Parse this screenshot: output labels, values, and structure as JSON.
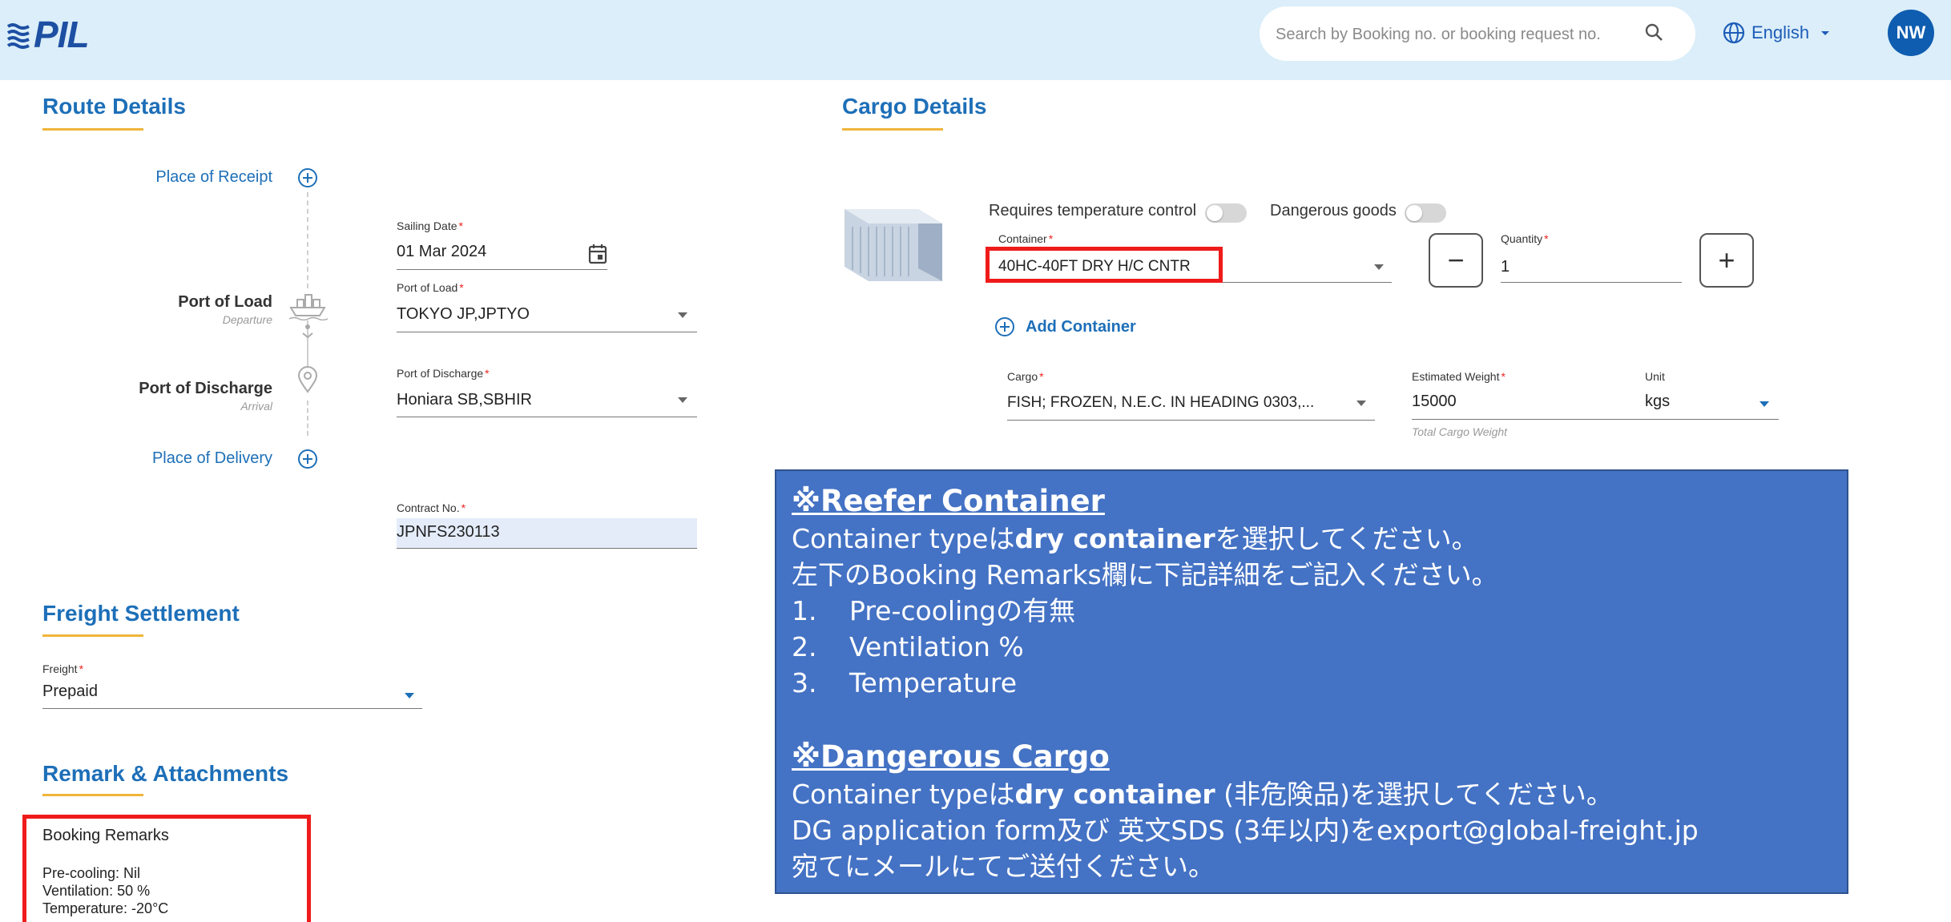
{
  "header": {
    "logo_text": "PIL",
    "search_placeholder": "Search by Booking no. or booking request no.",
    "language": "English",
    "avatar_initials": "NW"
  },
  "route": {
    "title": "Route Details",
    "place_of_receipt": "Place of Receipt",
    "port_of_load": "Port of Load",
    "port_of_load_sub": "Departure",
    "port_of_discharge": "Port of Discharge",
    "port_of_discharge_sub": "Arrival",
    "place_of_delivery": "Place of Delivery",
    "sailing_date_label": "Sailing Date",
    "sailing_date_value": "01 Mar 2024",
    "port_of_load_field_label": "Port of Load",
    "port_of_load_value": "TOKYO JP,JPTYO",
    "port_of_discharge_field_label": "Port of Discharge",
    "port_of_discharge_value": "Honiara SB,SBHIR",
    "contract_label": "Contract No.",
    "contract_value": "JPNFS230113"
  },
  "freight": {
    "title": "Freight Settlement",
    "label": "Freight",
    "value": "Prepaid"
  },
  "remarks": {
    "title": "Remark & Attachments",
    "box_title": "Booking Remarks",
    "lines": [
      "Pre-cooling: Nil",
      "Ventilation: 50 %",
      "Temperature: -20°C"
    ]
  },
  "cargo": {
    "title": "Cargo Details",
    "requires_temp_label": "Requires temperature control",
    "requires_temp_on": false,
    "dangerous_goods_label": "Dangerous goods",
    "dangerous_goods_on": false,
    "container_label": "Container",
    "container_value": "40HC-40FT DRY H/C CNTR",
    "quantity_label": "Quantity",
    "quantity_value": "1",
    "minus": "−",
    "plus": "+",
    "add_container": "Add Container",
    "cargo_label": "Cargo",
    "cargo_value": "FISH; FROZEN, N.E.C. IN HEADING 0303,...",
    "weight_label": "Estimated Weight",
    "weight_value": "15000",
    "weight_hint": "Total Cargo Weight",
    "unit_label": "Unit",
    "unit_value": "kgs"
  },
  "note": {
    "reefer_heading": "※Reefer Container",
    "reefer_line1_a": "Container typeは",
    "reefer_line1_b": "dry container",
    "reefer_line1_c": "を選択してください。",
    "reefer_line2": "左下のBooking Remarks欄に下記詳細をご記入ください。",
    "items": [
      {
        "num": "1.",
        "text": "Pre-coolingの有無"
      },
      {
        "num": "2.",
        "text": "Ventilation %"
      },
      {
        "num": "3.",
        "text": "Temperature"
      }
    ],
    "dg_heading": "※Dangerous Cargo",
    "dg_line1_a": "Container typeは",
    "dg_line1_b": "dry container",
    "dg_line1_c": " (非危険品)を選択してください。",
    "dg_line2": "DG application form及び 英文SDS (3年以内)をexport@global-freight.jp",
    "dg_line3": "宛てにメールにてご送付ください。"
  },
  "colors": {
    "header_bg": "#dbeef9",
    "accent_blue": "#1d6fb8",
    "underline_gold": "#f0b53a",
    "note_bg": "#4472c4",
    "highlight_red": "#ef1b1b"
  }
}
